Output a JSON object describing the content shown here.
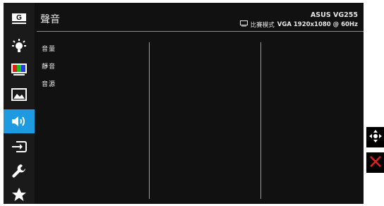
{
  "sidebar": {
    "items": [
      {
        "name": "splendid-icon",
        "active": false
      },
      {
        "name": "blue-light-filter-icon",
        "active": false
      },
      {
        "name": "color-icon",
        "active": false
      },
      {
        "name": "image-icon",
        "active": false
      },
      {
        "name": "sound-icon",
        "active": true
      },
      {
        "name": "input-select-icon",
        "active": false
      },
      {
        "name": "system-setup-icon",
        "active": false
      },
      {
        "name": "my-favorite-icon",
        "active": false
      }
    ],
    "splendid_letter": "G"
  },
  "header": {
    "title": "聲音",
    "model": "ASUS VG255",
    "mode_label": "比賽模式",
    "resolution": "VGA 1920x1080 @ 60Hz"
  },
  "menu": {
    "items": [
      "音量",
      "靜音",
      "音源"
    ]
  },
  "side_buttons": {
    "navigate": "navigate-icon",
    "close": "close-icon"
  },
  "colors": {
    "accent": "#1e9be0",
    "background": "#111111",
    "close": "#e02020"
  }
}
